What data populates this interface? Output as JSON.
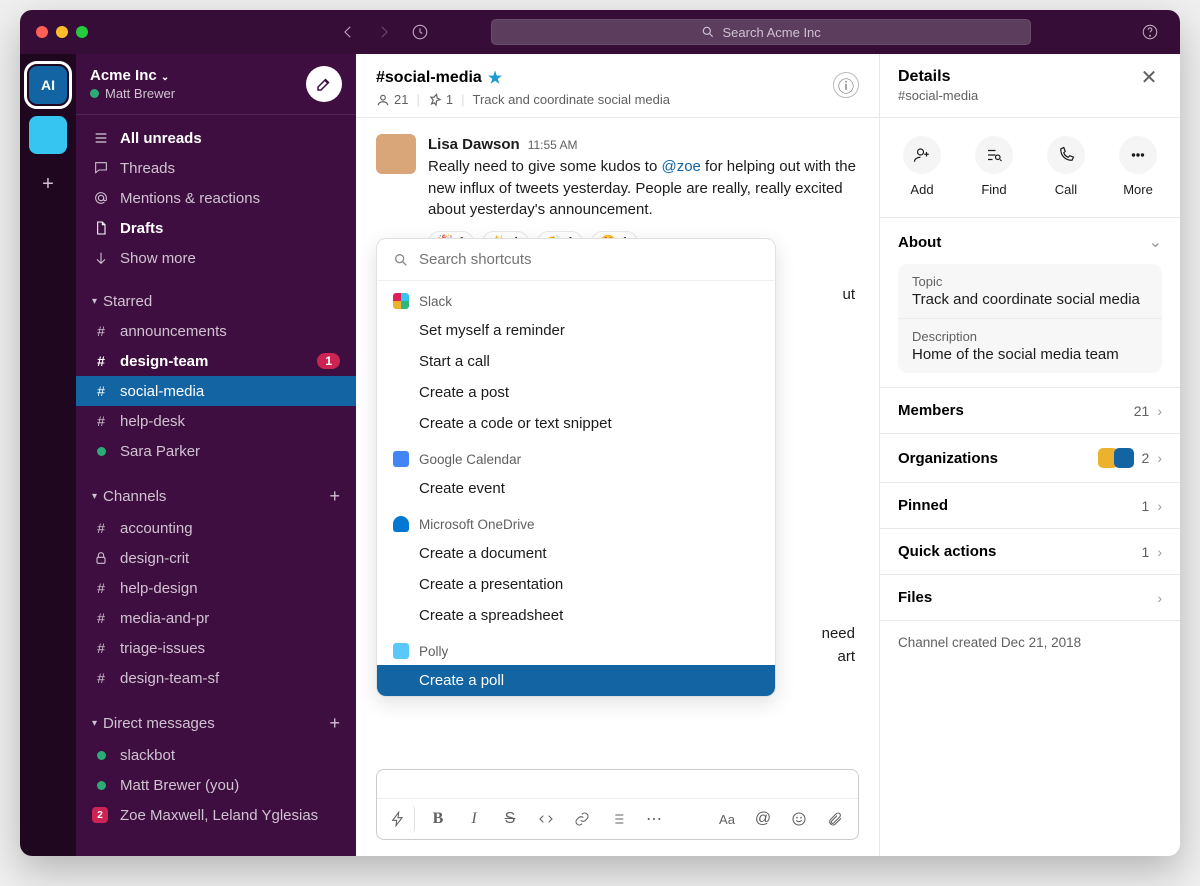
{
  "titlebar": {
    "search_placeholder": "Search Acme Inc"
  },
  "workspace": {
    "name": "Acme Inc",
    "user": "Matt Brewer",
    "badge_initials": "AI"
  },
  "sidebar": {
    "nav": {
      "all_unreads": "All unreads",
      "threads": "Threads",
      "mentions": "Mentions & reactions",
      "drafts": "Drafts",
      "show_more": "Show more"
    },
    "sections": {
      "starred": "Starred",
      "channels": "Channels",
      "dms": "Direct messages"
    },
    "starred": [
      {
        "prefix": "#",
        "name": "announcements"
      },
      {
        "prefix": "#",
        "name": "design-team",
        "unread": true,
        "badge": "1"
      },
      {
        "prefix": "#",
        "name": "social-media",
        "selected": true
      },
      {
        "prefix": "#",
        "name": "help-desk"
      },
      {
        "prefix": "●",
        "name": "Sara Parker",
        "dm": true
      }
    ],
    "channels": [
      {
        "prefix": "#",
        "name": "accounting"
      },
      {
        "prefix": "lock",
        "name": "design-crit"
      },
      {
        "prefix": "#",
        "name": "help-design"
      },
      {
        "prefix": "#",
        "name": "media-and-pr"
      },
      {
        "prefix": "#",
        "name": "triage-issues"
      },
      {
        "prefix": "#",
        "name": "design-team-sf"
      }
    ],
    "dms": [
      {
        "name": "slackbot",
        "online": true
      },
      {
        "name": "Matt Brewer (you)",
        "online": true
      },
      {
        "name": "Zoe Maxwell, Leland Yglesias",
        "group": true,
        "count": "2"
      }
    ]
  },
  "channel": {
    "name": "#social-media",
    "members": "21",
    "pinned": "1",
    "topic": "Track and coordinate social media"
  },
  "message": {
    "author": "Lisa Dawson",
    "time": "11:55 AM",
    "text_pre": "Really need to give some kudos to ",
    "mention": "@zoe",
    "text_post": " for helping out with the new influx of tweets yesterday. People are really, really excited about yesterday's announcement.",
    "reactions": [
      {
        "emoji": "🎉",
        "count": "1"
      },
      {
        "emoji": "✨",
        "count": "1"
      },
      {
        "emoji": "👏",
        "count": "1"
      },
      {
        "emoji": "😍",
        "count": "1"
      }
    ]
  },
  "shortcuts": {
    "placeholder": "Search shortcuts",
    "groups": [
      {
        "app": "Slack",
        "items": [
          "Set myself a reminder",
          "Start a call",
          "Create a post",
          "Create a code or text snippet"
        ]
      },
      {
        "app": "Google Calendar",
        "items": [
          "Create event"
        ]
      },
      {
        "app": "Microsoft OneDrive",
        "items": [
          "Create a document",
          "Create a presentation",
          "Create a spreadsheet"
        ]
      },
      {
        "app": "Polly",
        "items": [
          "Create a poll"
        ],
        "selected_index": 0
      }
    ]
  },
  "bg_hints": {
    "a": "ut",
    "b": "need",
    "c": "art"
  },
  "details": {
    "title": "Details",
    "subtitle": "#social-media",
    "actions": {
      "add": "Add",
      "find": "Find",
      "call": "Call",
      "more": "More"
    },
    "about_label": "About",
    "topic_label": "Topic",
    "topic_value": "Track and coordinate social media",
    "description_label": "Description",
    "description_value": "Home of the social media team",
    "rows": {
      "members": {
        "label": "Members",
        "value": "21"
      },
      "organizations": {
        "label": "Organizations",
        "value": "2"
      },
      "pinned": {
        "label": "Pinned",
        "value": "1"
      },
      "quick_actions": {
        "label": "Quick actions",
        "value": "1"
      },
      "files": {
        "label": "Files"
      }
    },
    "footer": "Channel created Dec 21, 2018"
  }
}
